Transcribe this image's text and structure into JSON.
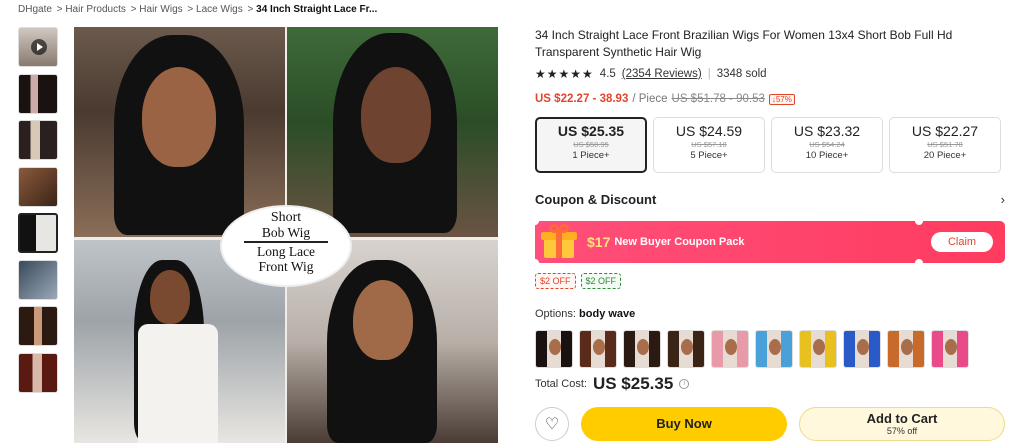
{
  "breadcrumb": {
    "items": [
      "DHgate",
      "Hair Products",
      "Hair Wigs",
      "Lace Wigs"
    ],
    "current": "34 Inch Straight Lace Fr..."
  },
  "gallery": {
    "thumbs": 8,
    "active_index": 4,
    "overlay": {
      "line1": "Short",
      "line2": "Bob Wig",
      "line3": "Long Lace",
      "line4": "Front Wig"
    }
  },
  "product": {
    "title": "34 Inch Straight Lace Front Brazilian Wigs For Women 13x4 Short Bob Full Hd Transparent Synthetic Hair Wig",
    "rating": "4.5",
    "reviews": "(2354 Reviews)",
    "sold": "3348 sold",
    "price_range": "US $22.27 - 38.93",
    "per": "/ Piece",
    "original_range": "US $51.78 - 90.53",
    "discount": "↓57%"
  },
  "tiers": [
    {
      "price": "US $25.35",
      "orig": "US $58.95",
      "qty": "1 Piece+",
      "selected": true
    },
    {
      "price": "US $24.59",
      "orig": "US $57.18",
      "qty": "5 Piece+",
      "selected": false
    },
    {
      "price": "US $23.32",
      "orig": "US $54.24",
      "qty": "10 Piece+",
      "selected": false
    },
    {
      "price": "US $22.27",
      "orig": "US $51.78",
      "qty": "20 Piece+",
      "selected": false
    }
  ],
  "coupon": {
    "heading": "Coupon & Discount",
    "amount": "$17",
    "text": "New Buyer Coupon Pack",
    "claim": "Claim",
    "chip1": "$2 OFF",
    "chip2": "$2 OFF"
  },
  "options": {
    "label": "Options:",
    "value": "body wave",
    "swatches": [
      "#1a1210",
      "#5a2a1a",
      "#2a1a12",
      "#3a2416",
      "#e89aa8",
      "#4aa0d8",
      "#e8c020",
      "#2a5ac8",
      "#c86a2a",
      "#e84a8a"
    ]
  },
  "total": {
    "label": "Total Cost:",
    "value": "US $25.35",
    "info": "i"
  },
  "actions": {
    "buy": "Buy Now",
    "cart": "Add to Cart",
    "cart_sub": "57% off"
  }
}
